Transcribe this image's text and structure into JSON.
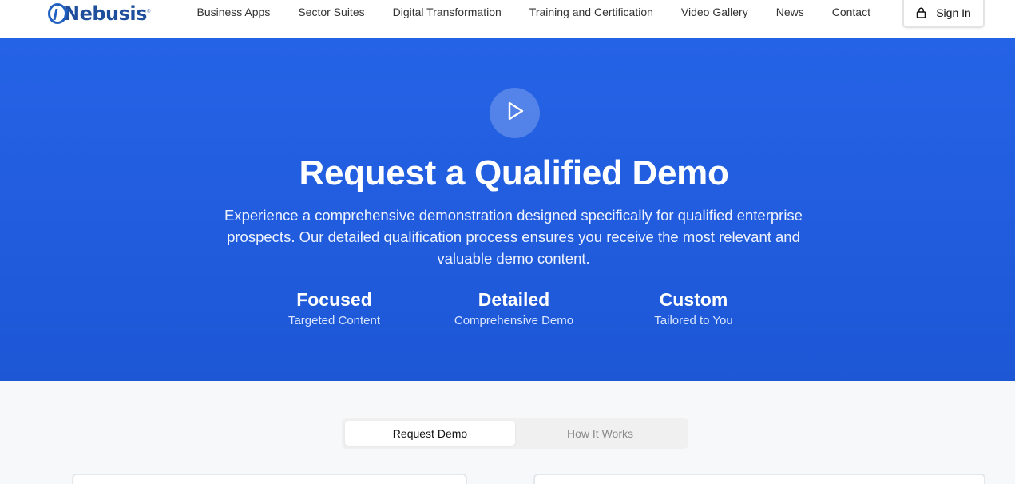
{
  "brand": {
    "name": "Nebusis",
    "registered": "®"
  },
  "nav": {
    "items": [
      {
        "label": "Business Apps"
      },
      {
        "label": "Sector Suites"
      },
      {
        "label": "Digital Transformation"
      },
      {
        "label": "Training and Certification"
      },
      {
        "label": "Video Gallery"
      },
      {
        "label": "News"
      },
      {
        "label": "Contact"
      }
    ],
    "signin_label": "Sign In"
  },
  "hero": {
    "title": "Request a Qualified Demo",
    "description": "Experience a comprehensive demonstration designed specifically for qualified enterprise prospects. Our detailed qualification process ensures you receive the most relevant and valuable demo content.",
    "stats": [
      {
        "value": "Focused",
        "label": "Targeted Content"
      },
      {
        "value": "Detailed",
        "label": "Comprehensive Demo"
      },
      {
        "value": "Custom",
        "label": "Tailored to You"
      }
    ]
  },
  "tabs": [
    {
      "label": "Request Demo",
      "active": true
    },
    {
      "label": "How It Works",
      "active": false
    }
  ],
  "colors": {
    "hero_bg": "#2160e4",
    "brand_blue": "#1f4f9c",
    "header_bg": "#ffffff",
    "page_bg": "#f7f8fa"
  },
  "icons": {
    "play": "play-icon",
    "lock": "lock-icon",
    "logo": "nebusis-logo"
  }
}
